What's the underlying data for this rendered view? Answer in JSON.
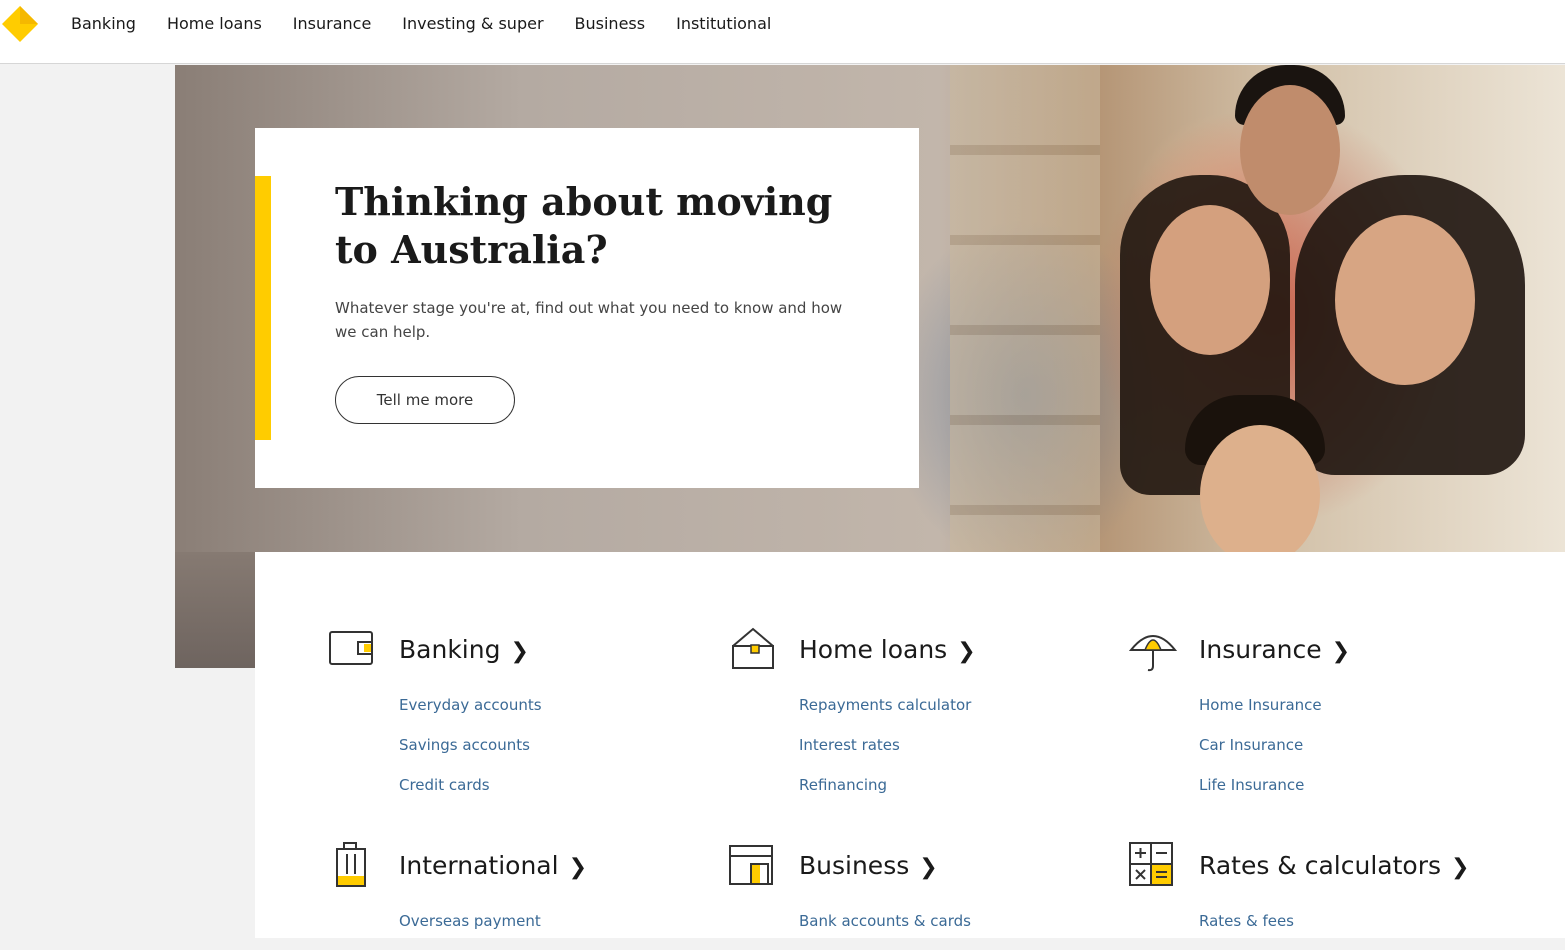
{
  "nav": {
    "logo_icon": "commbank-diamond-logo",
    "items": [
      {
        "label": "Banking"
      },
      {
        "label": "Home loans"
      },
      {
        "label": "Insurance"
      },
      {
        "label": "Investing & super"
      },
      {
        "label": "Business"
      },
      {
        "label": "Institutional"
      }
    ]
  },
  "hero": {
    "title": "Thinking about moving to Australia?",
    "subtitle": "Whatever stage you're at, find out what you need to know and how we can help.",
    "button": "Tell me more",
    "accent_color": "#ffcc00"
  },
  "categories": [
    {
      "title": "Banking",
      "icon": "wallet-icon",
      "links": [
        "Everyday accounts",
        "Savings accounts",
        "Credit cards"
      ]
    },
    {
      "title": "Home loans",
      "icon": "house-icon",
      "links": [
        "Repayments calculator",
        "Interest rates",
        "Refinancing"
      ]
    },
    {
      "title": "Insurance",
      "icon": "umbrella-icon",
      "links": [
        "Home Insurance",
        "Car Insurance",
        "Life Insurance"
      ]
    },
    {
      "title": "International",
      "icon": "suitcase-icon",
      "links": [
        "Overseas payment"
      ]
    },
    {
      "title": "Business",
      "icon": "shopfront-icon",
      "links": [
        "Bank accounts & cards"
      ]
    },
    {
      "title": "Rates & calculators",
      "icon": "calculator-icon",
      "links": [
        "Rates & fees"
      ]
    }
  ],
  "colors": {
    "brand_yellow": "#ffcc00",
    "link_blue": "#3b6a96",
    "text": "#1a1a1a"
  }
}
